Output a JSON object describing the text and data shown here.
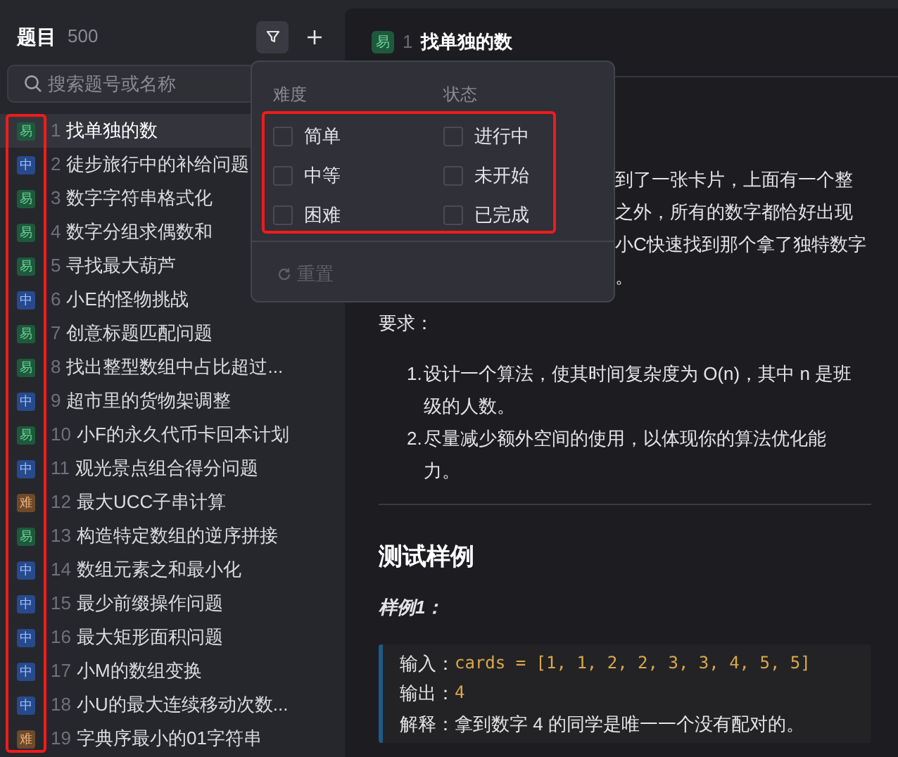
{
  "sidebar": {
    "title": "题目",
    "count": "500",
    "search": {
      "placeholder": "搜索题号或名称"
    },
    "problems": [
      {
        "kind": "easy",
        "badge": "易",
        "number": "1",
        "title": "找单独的数",
        "selected": true
      },
      {
        "kind": "medium",
        "badge": "中",
        "number": "2",
        "title": "徒步旅行中的补给问题",
        "selected": false
      },
      {
        "kind": "easy",
        "badge": "易",
        "number": "3",
        "title": "数字字符串格式化",
        "selected": false
      },
      {
        "kind": "easy",
        "badge": "易",
        "number": "4",
        "title": "数字分组求偶数和",
        "selected": false
      },
      {
        "kind": "easy",
        "badge": "易",
        "number": "5",
        "title": "寻找最大葫芦",
        "selected": false
      },
      {
        "kind": "medium",
        "badge": "中",
        "number": "6",
        "title": "小E的怪物挑战",
        "selected": false
      },
      {
        "kind": "easy",
        "badge": "易",
        "number": "7",
        "title": "创意标题匹配问题",
        "selected": false
      },
      {
        "kind": "easy",
        "badge": "易",
        "number": "8",
        "title": "找出整型数组中占比超过...",
        "selected": false
      },
      {
        "kind": "medium",
        "badge": "中",
        "number": "9",
        "title": "超市里的货物架调整",
        "selected": false
      },
      {
        "kind": "easy",
        "badge": "易",
        "number": "10",
        "title": "小F的永久代币卡回本计划",
        "selected": false
      },
      {
        "kind": "medium",
        "badge": "中",
        "number": "11",
        "title": "观光景点组合得分问题",
        "selected": false
      },
      {
        "kind": "hard",
        "badge": "难",
        "number": "12",
        "title": "最大UCC子串计算",
        "selected": false
      },
      {
        "kind": "easy",
        "badge": "易",
        "number": "13",
        "title": "构造特定数组的逆序拼接",
        "selected": false
      },
      {
        "kind": "medium",
        "badge": "中",
        "number": "14",
        "title": "数组元素之和最小化",
        "selected": false
      },
      {
        "kind": "medium",
        "badge": "中",
        "number": "15",
        "title": "最少前缀操作问题",
        "selected": false
      },
      {
        "kind": "medium",
        "badge": "中",
        "number": "16",
        "title": "最大矩形面积问题",
        "selected": false
      },
      {
        "kind": "medium",
        "badge": "中",
        "number": "17",
        "title": "小M的数组变换",
        "selected": false
      },
      {
        "kind": "medium",
        "badge": "中",
        "number": "18",
        "title": "小U的最大连续移动次数...",
        "selected": false
      },
      {
        "kind": "hard",
        "badge": "难",
        "number": "19",
        "title": "字典序最小的01字符串",
        "selected": false
      }
    ]
  },
  "problem": {
    "kind": "easy",
    "badge": "易",
    "number": "1",
    "title": "找单独的数",
    "description_fragments": [
      "到了一张卡片，上面有一个整",
      "之外，所有的数字都恰好出现",
      "小C快速找到那个拿了独特数字",
      "。"
    ],
    "requirements_label": "要求：",
    "requirements": [
      {
        "number": "1.",
        "text": "设计一个算法，使其时间复杂度为 O(n)，其中 n 是班级的人数。"
      },
      {
        "number": "2.",
        "text": "尽量减少额外空间的使用，以体现你的算法优化能力。"
      }
    ],
    "section_title": "测试样例",
    "example_title": "样例1：",
    "example_lines": [
      {
        "kind": "code",
        "label": "输入：",
        "value": "cards = [1, 1, 2, 2, 3, 3, 4, 5, 5]"
      },
      {
        "kind": "code",
        "label": "输出：",
        "value": "4"
      },
      {
        "kind": "text",
        "label": "解释：",
        "value": "拿到数字 4 的同学是唯一一个没有配对的。"
      }
    ]
  },
  "filter_popup": {
    "groups": [
      {
        "title": "难度",
        "options": [
          {
            "label": "简单",
            "checked": false
          },
          {
            "label": "中等",
            "checked": false
          },
          {
            "label": "困难",
            "checked": false
          }
        ]
      },
      {
        "title": "状态",
        "options": [
          {
            "label": "进行中",
            "checked": false
          },
          {
            "label": "未开始",
            "checked": false
          },
          {
            "label": "已完成",
            "checked": false
          }
        ]
      }
    ],
    "reset": {
      "label": "重置",
      "disabled": true
    }
  }
}
